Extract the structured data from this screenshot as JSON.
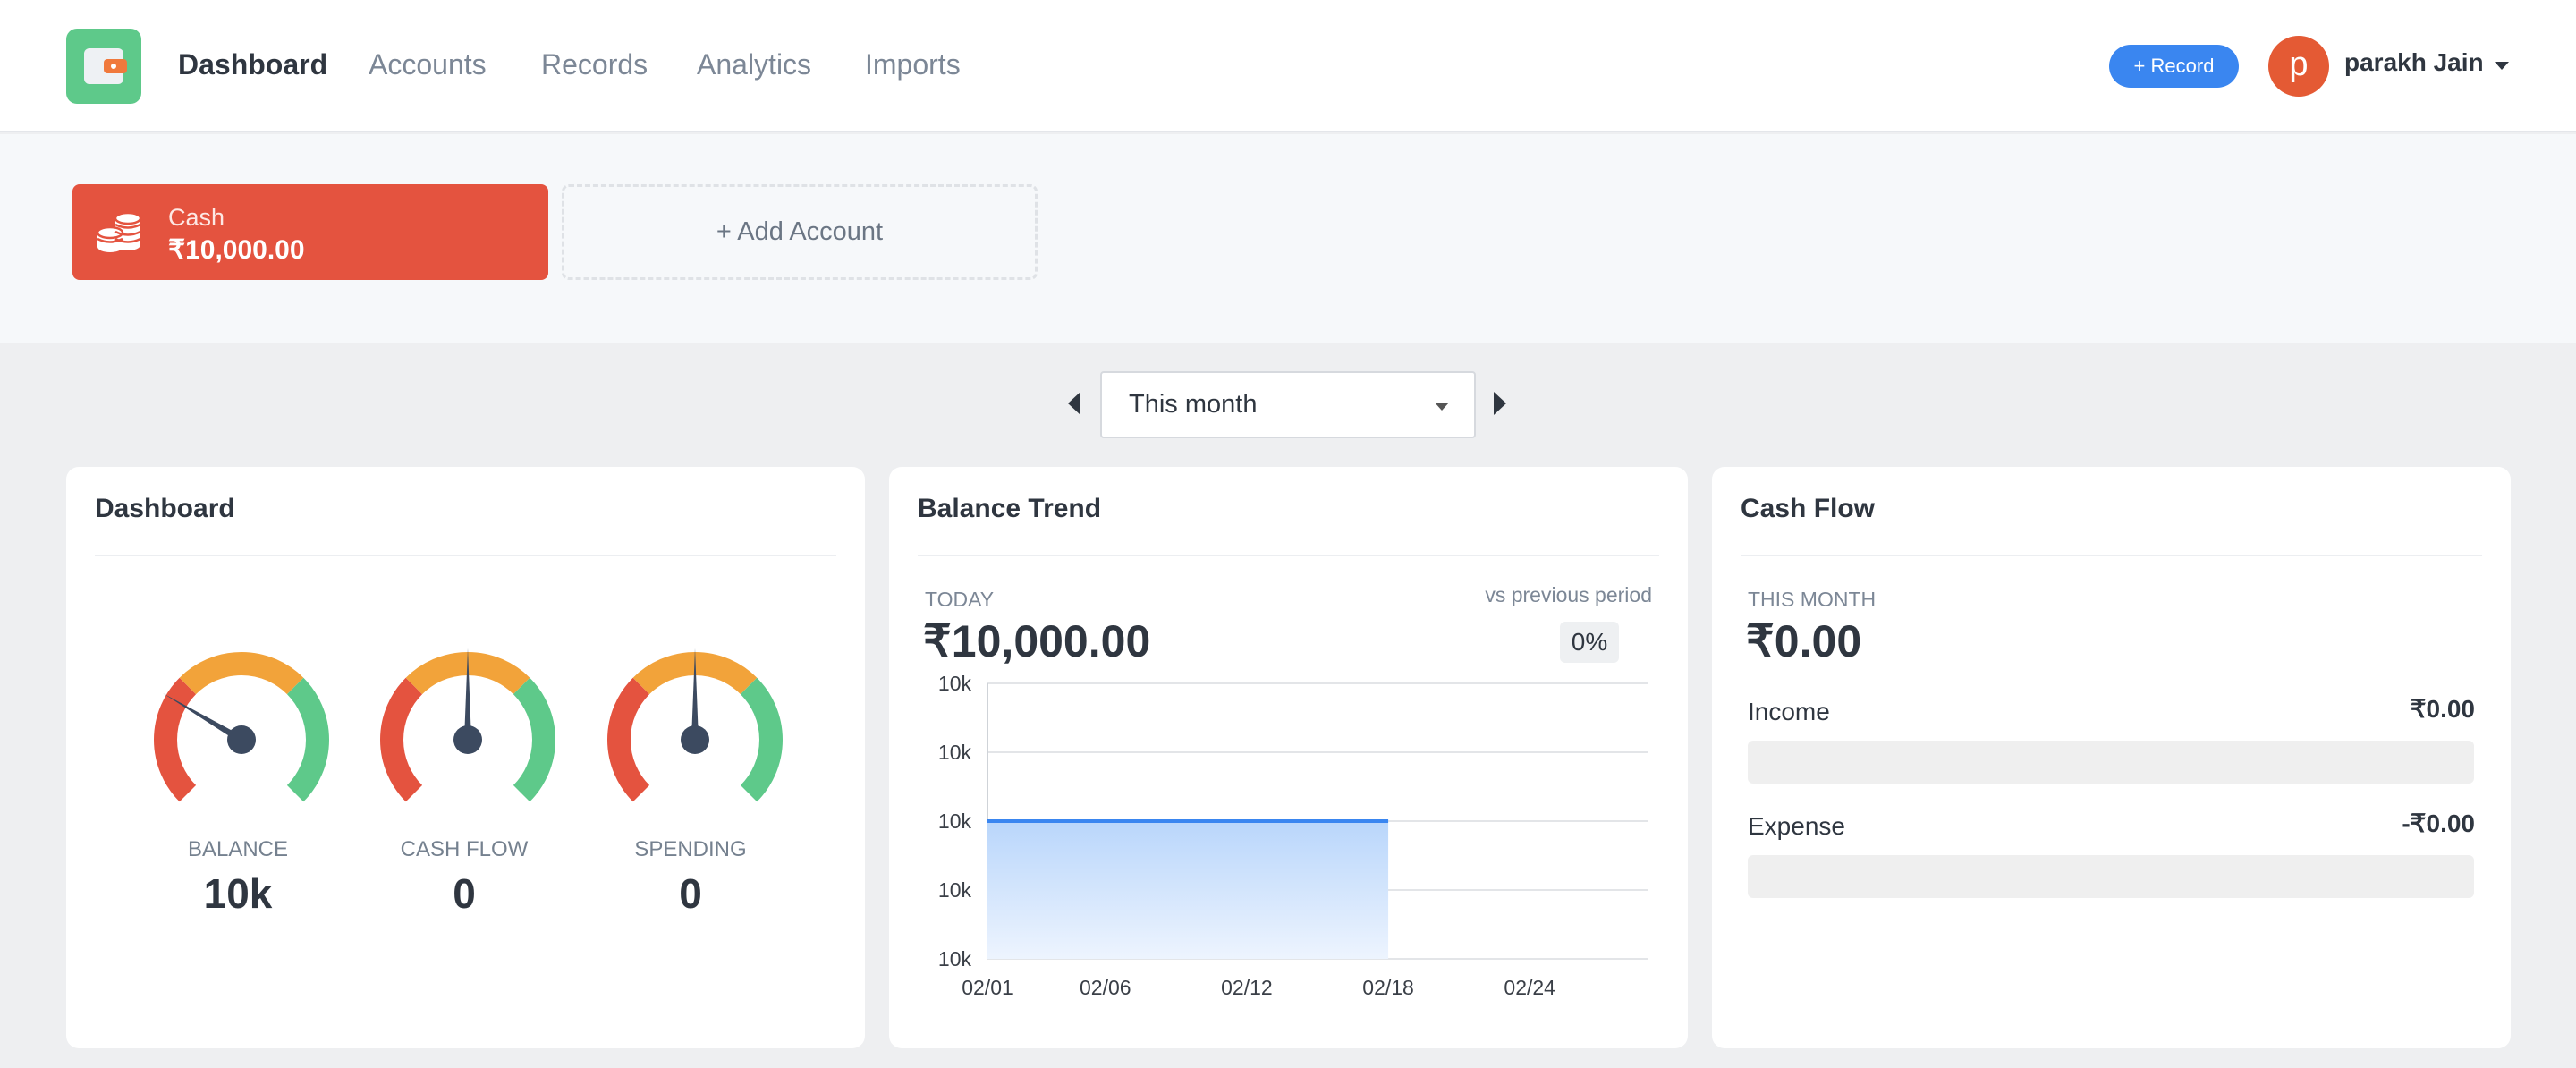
{
  "header": {
    "nav": [
      "Dashboard",
      "Accounts",
      "Records",
      "Analytics",
      "Imports"
    ],
    "record_button": "+ Record",
    "user": {
      "initial": "p",
      "name": "parakh Jain"
    }
  },
  "accounts": {
    "items": [
      {
        "name": "Cash",
        "balance": "₹10,000.00",
        "color": "#e4533f"
      }
    ],
    "add_label": "+ Add Account"
  },
  "period": {
    "selected": "This month"
  },
  "dashboard_card": {
    "title": "Dashboard",
    "gauges": [
      {
        "label": "BALANCE",
        "value": "10k",
        "needle_fraction": 0.28
      },
      {
        "label": "CASH FLOW",
        "value": "0",
        "needle_fraction": 0.5
      },
      {
        "label": "SPENDING",
        "value": "0",
        "needle_fraction": 0.5
      }
    ]
  },
  "balance_trend": {
    "title": "Balance Trend",
    "today_label": "TODAY",
    "today_value": "₹10,000.00",
    "vs_label": "vs previous period",
    "change": "0%"
  },
  "cash_flow": {
    "title": "Cash Flow",
    "period_label": "THIS MONTH",
    "total": "₹0.00",
    "income_label": "Income",
    "income_value": "₹0.00",
    "expense_label": "Expense",
    "expense_value": "-₹0.00"
  },
  "chart_data": {
    "type": "area",
    "title": "",
    "xlabel": "",
    "ylabel": "",
    "x_ticks": [
      "02/01",
      "02/06",
      "02/12",
      "02/18",
      "02/24"
    ],
    "y_ticks": [
      "10k",
      "10k",
      "10k",
      "10k",
      "10k"
    ],
    "x": [
      "02/01",
      "02/18"
    ],
    "y": [
      10000,
      10000
    ],
    "ylim": [
      10000,
      10000
    ],
    "grid": true,
    "color": "#3a86f0"
  }
}
